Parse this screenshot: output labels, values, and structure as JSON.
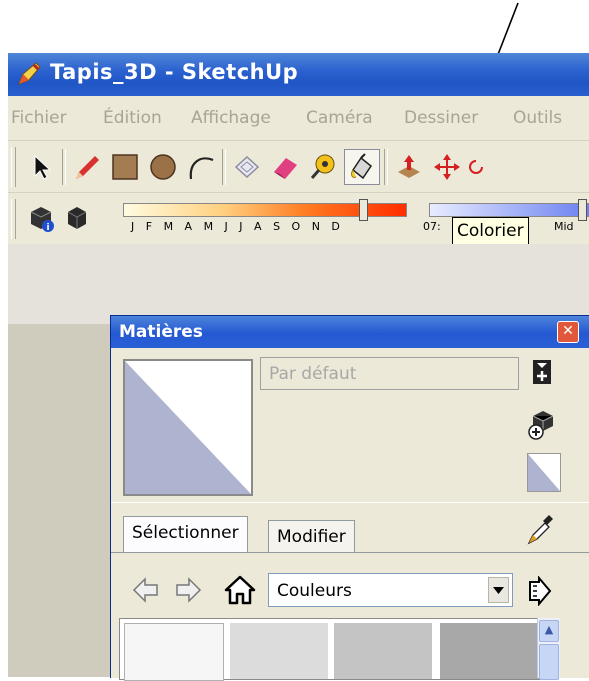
{
  "window": {
    "title": "Tapis_3D - SketchUp"
  },
  "menu": [
    "Fichier",
    "Édition",
    "Affichage",
    "Caméra",
    "Dessiner",
    "Outils"
  ],
  "toolbar1": {
    "tools": [
      "select-icon",
      "pencil-icon",
      "rectangle-icon",
      "circle-icon",
      "arc-icon",
      "make-component-icon",
      "eraser-icon",
      "tape-measure-icon",
      "paint-bucket-icon",
      "push-pull-icon",
      "move-icon",
      "rotate-icon"
    ]
  },
  "toolbar2": {
    "month_letters": "J F M A M J J A S O N D",
    "time_label": "07:",
    "noon_label": "Mid"
  },
  "tooltip": {
    "text": "Colorier"
  },
  "materials_dialog": {
    "title": "Matières",
    "name_field": "Par défaut",
    "tabs": {
      "select": "Sélectionner",
      "edit": "Modifier"
    },
    "library": "Couleurs",
    "swatches": [
      "#f6f6f6",
      "#dcdcdc",
      "#c4c4c4",
      "#a8a8a8"
    ]
  },
  "colors": {
    "titlebar": "#2c63cf",
    "preview_default": "#aeb3cf",
    "sun_gradient_start": "#fffbe0",
    "sun_gradient_end": "#ff2e00"
  }
}
